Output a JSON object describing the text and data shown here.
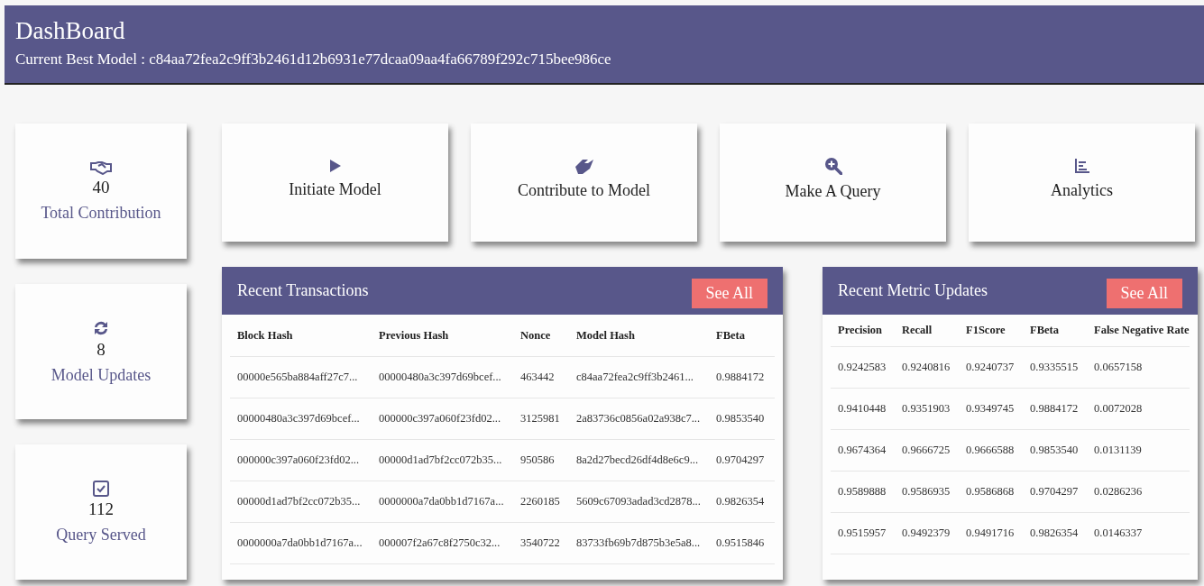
{
  "header": {
    "title": "DashBoard",
    "subtitle": "Current Best Model : c84aa72fea2c9ff3b2461d12b6931e77dcaa09aa4fa66789f292c715bee986ce"
  },
  "stats": [
    {
      "value": "40",
      "label": "Total Contribution"
    },
    {
      "value": "8",
      "label": "Model Updates"
    },
    {
      "value": "112",
      "label": "Query Served"
    }
  ],
  "actions": [
    "Initiate Model",
    "Contribute to Model",
    "Make A Query",
    "Analytics"
  ],
  "transactions": {
    "title": "Recent Transactions",
    "button": "See All",
    "columns": [
      "Block Hash",
      "Previous Hash",
      "Nonce",
      "Model Hash",
      "FBeta"
    ],
    "rows": [
      [
        "00000e565ba884aff27c7...",
        "00000480a3c397d69bcef...",
        "463442",
        "c84aa72fea2c9ff3b2461...",
        "0.9884172"
      ],
      [
        "00000480a3c397d69bcef...",
        "000000c397a060f23fd02...",
        "3125981",
        "2a83736c0856a02a938c7...",
        "0.9853540"
      ],
      [
        "000000c397a060f23fd02...",
        "00000d1ad7bf2cc072b35...",
        "950586",
        "8a2d27becd26df4d8e6c9...",
        "0.9704297"
      ],
      [
        "00000d1ad7bf2cc072b35...",
        "0000000a7da0bb1d7167a...",
        "2260185",
        "5609c67093adad3cd2878...",
        "0.9826354"
      ],
      [
        "0000000a7da0bb1d7167a...",
        "000007f2a67c8f2750c32...",
        "3540722",
        "83733fb69b7d875b3e5a8...",
        "0.9515846"
      ]
    ]
  },
  "metrics": {
    "title": "Recent Metric Updates",
    "button": "See All",
    "columns": [
      "Precision",
      "Recall",
      "F1Score",
      "FBeta",
      "False Negative Rate"
    ],
    "rows": [
      [
        "0.9242583",
        "0.9240816",
        "0.9240737",
        "0.9335515",
        "0.0657158"
      ],
      [
        "0.9410448",
        "0.9351903",
        "0.9349745",
        "0.9884172",
        "0.0072028"
      ],
      [
        "0.9674364",
        "0.9666725",
        "0.9666588",
        "0.9853540",
        "0.0131139"
      ],
      [
        "0.9589888",
        "0.9586935",
        "0.9586868",
        "0.9704297",
        "0.0286236"
      ],
      [
        "0.9515957",
        "0.9492379",
        "0.9491716",
        "0.9826354",
        "0.0146337"
      ]
    ]
  }
}
